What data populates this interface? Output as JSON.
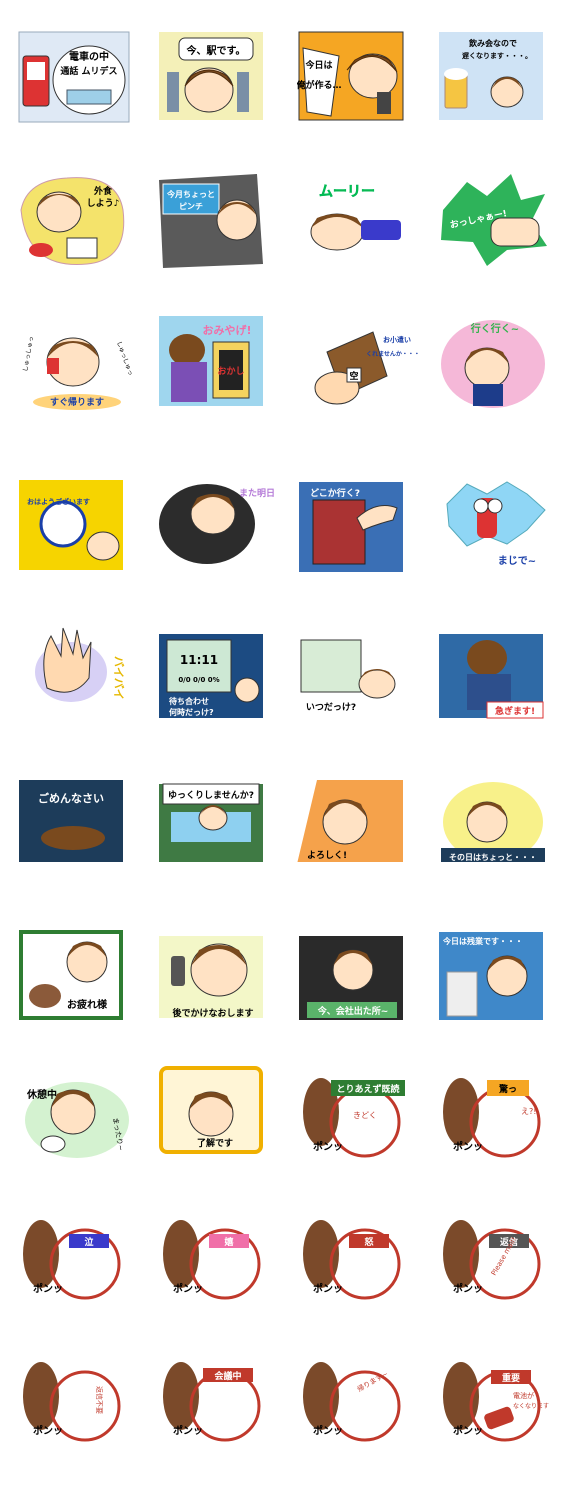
{
  "colors": {
    "hair": "#7a4a1e",
    "hair_dark": "#4e2c0c",
    "skin": "#ffe2c4",
    "stamp_red": "#c0392b",
    "stamp_handle": "#7b4a2a"
  },
  "rows": [
    [
      {
        "texts": [
          "電車の中",
          "通話 ムリデス"
        ],
        "bg": "#dfe9f5"
      },
      {
        "texts": [
          "今、駅です。"
        ],
        "bg": "#f4f0b8"
      },
      {
        "texts": [
          "今日は",
          "俺が作る…"
        ],
        "bg": "#f5a623"
      },
      {
        "texts": [
          "飲み会なので",
          "遅くなります・・・。"
        ],
        "bg": "#cfe3f5"
      }
    ],
    [
      {
        "texts": [
          "外食",
          "しよう♪"
        ],
        "bg": "#f4e36b"
      },
      {
        "texts": [
          "今月ちょっと",
          "ピンチ"
        ],
        "bg": "#5a5a5a"
      },
      {
        "texts": [
          "ムーリー"
        ],
        "bg": "#ffffff"
      },
      {
        "texts": [
          "おっしゃぁー!"
        ],
        "bg": "#ffffff"
      }
    ],
    [
      {
        "texts": [
          "すぐ帰ります",
          "しゅっしゅっ",
          "しゅっしゅっ"
        ],
        "bg": "#ffffff"
      },
      {
        "texts": [
          "おみやげ!",
          "おかし"
        ],
        "bg": "#9fd6ee"
      },
      {
        "texts": [
          "空",
          "お小遣い",
          "くれませんか・・・"
        ],
        "bg": "#ffffff"
      },
      {
        "texts": [
          "行く行く~"
        ],
        "bg": "#f5b8d8"
      }
    ],
    [
      {
        "texts": [
          "おはようございます"
        ],
        "bg": "#f6d400"
      },
      {
        "texts": [
          "また明日"
        ],
        "bg": "#2c2c2c"
      },
      {
        "texts": [
          "どこか行く?"
        ],
        "bg": "#3a6fb5"
      },
      {
        "texts": [
          "まじで~"
        ],
        "bg": "#ffffff"
      }
    ],
    [
      {
        "texts": [
          "バイバイ"
        ],
        "bg": "#ffffff"
      },
      {
        "texts": [
          "11:11",
          "0/0 0/0 0%",
          "待ち合わせ",
          "何時だっけ?"
        ],
        "bg": "#1c4b82"
      },
      {
        "texts": [
          "いつだっけ?"
        ],
        "bg": "#ffffff"
      },
      {
        "texts": [
          "急ぎます!"
        ],
        "bg": "#2f6aa6"
      }
    ],
    [
      {
        "texts": [
          "ごめんなさい"
        ],
        "bg": "#1d3c5a"
      },
      {
        "texts": [
          "ゆっくりしませんか?"
        ],
        "bg": "#3f7a44"
      },
      {
        "texts": [
          "よろしく!"
        ],
        "bg": "#f5a24b"
      },
      {
        "texts": [
          "その日はちょっと・・・"
        ],
        "bg": "#f8f18a"
      }
    ],
    [
      {
        "texts": [
          "お疲れ様"
        ],
        "bg": "#ffffff"
      },
      {
        "texts": [
          "後でかけなおします"
        ],
        "bg": "#f3f7c8"
      },
      {
        "texts": [
          "今、会社出た所~"
        ],
        "bg": "#2a2a2a"
      },
      {
        "texts": [
          "今日は残業です・・・"
        ],
        "bg": "#3f88c9"
      }
    ],
    [
      {
        "texts": [
          "休憩中",
          "まったり~"
        ],
        "bg": "#ffffff"
      },
      {
        "texts": [
          "了解です"
        ],
        "bg": "#fff5d6"
      },
      {
        "texts": [
          "とりあえず既読",
          "ポンッ",
          "きどく"
        ],
        "bg": "#ffffff"
      },
      {
        "texts": [
          "驚っ",
          "ポンッ",
          "え?!"
        ],
        "bg": "#ffffff"
      }
    ],
    [
      {
        "texts": [
          "泣",
          "ポンッ"
        ],
        "bg": "#ffffff"
      },
      {
        "texts": [
          "嬉",
          "ポンッ"
        ],
        "bg": "#ffffff"
      },
      {
        "texts": [
          "怒",
          "ポンッ"
        ],
        "bg": "#ffffff"
      },
      {
        "texts": [
          "返信",
          "ポンッ",
          "Please mail!"
        ],
        "bg": "#ffffff"
      }
    ],
    [
      {
        "texts": [
          "ポンッ",
          "返信不要"
        ],
        "bg": "#ffffff"
      },
      {
        "texts": [
          "会議中",
          "ポンッ"
        ],
        "bg": "#ffffff"
      },
      {
        "texts": [
          "ポンッ",
          "帰ります~"
        ],
        "bg": "#ffffff"
      },
      {
        "texts": [
          "重要",
          "ポンッ",
          "電池が",
          "なくなります"
        ],
        "bg": "#ffffff"
      }
    ]
  ]
}
